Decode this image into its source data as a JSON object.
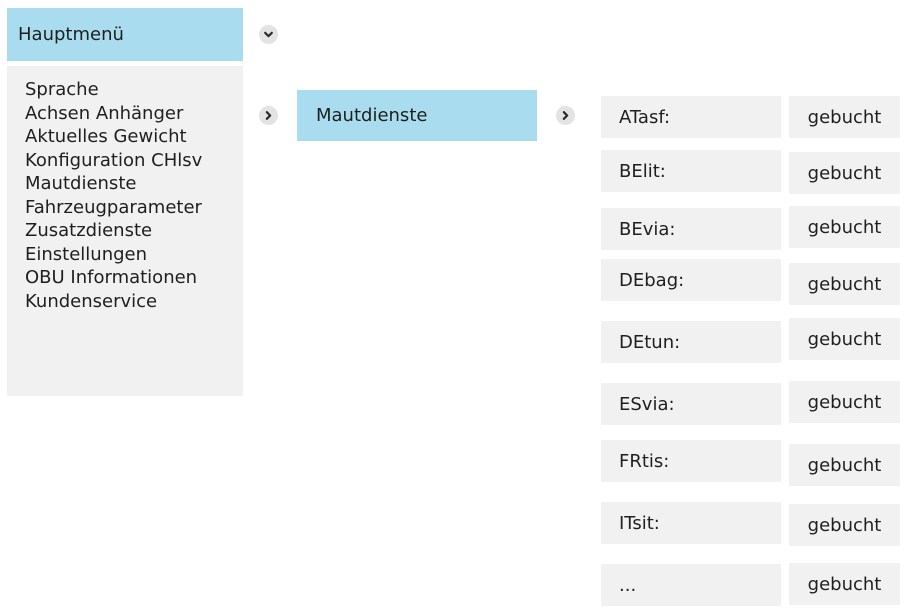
{
  "main_menu": {
    "title": "Hauptmenü",
    "items": [
      "Sprache",
      "Achsen Anhänger",
      "Aktuelles Gewicht",
      "Konfiguration CHlsv",
      "Mautdienste",
      "Fahrzeugparameter",
      "Zusatzdienste",
      "Einstellungen",
      "OBU Informationen",
      "Kundenservice"
    ]
  },
  "submenu": {
    "title": "Mautdienste"
  },
  "services": [
    {
      "name": "ATasf:",
      "status": "gebucht"
    },
    {
      "name": "BElit:",
      "status": "gebucht"
    },
    {
      "name": "BEvia:",
      "status": "gebucht"
    },
    {
      "name": "DEbag:",
      "status": "gebucht"
    },
    {
      "name": "DEtun:",
      "status": "gebucht"
    },
    {
      "name": "ESvia:",
      "status": "gebucht"
    },
    {
      "name": "FRtis:",
      "status": "gebucht"
    },
    {
      "name": "ITsit:",
      "status": "gebucht"
    },
    {
      "name": "...",
      "status": "gebucht"
    }
  ],
  "icons": {
    "expand": "chevron-down-icon",
    "navigate": "chevron-right-icon"
  },
  "colors": {
    "header_bg": "#a9dcee",
    "panel_bg": "#f1f1f1",
    "icon_bg": "#e3e3e3",
    "text": "#1f1f1f"
  }
}
